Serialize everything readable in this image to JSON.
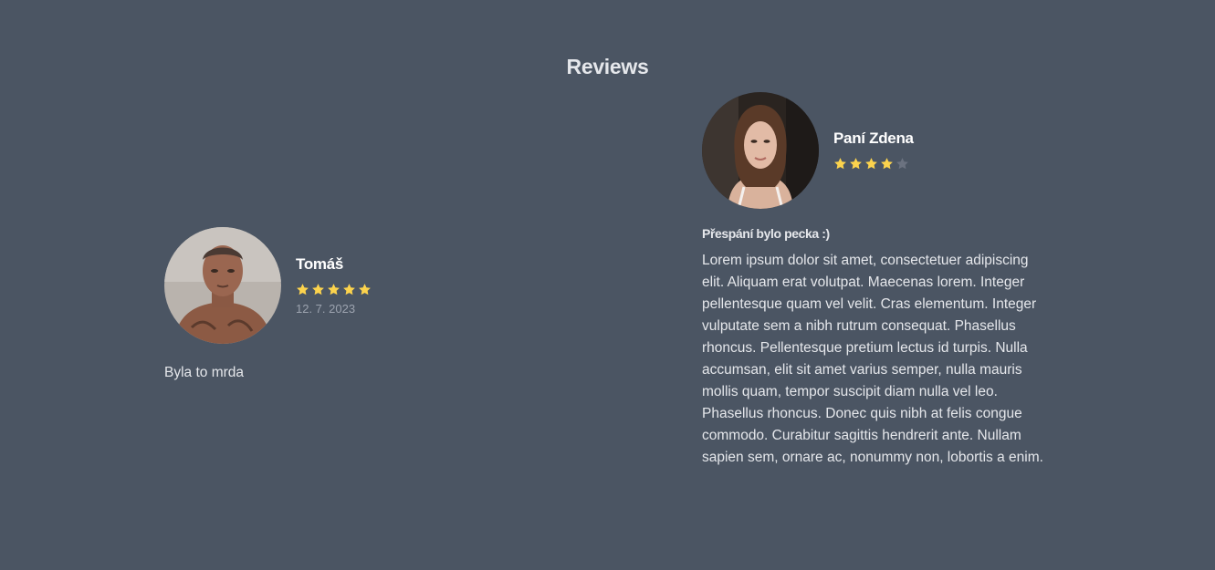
{
  "section": {
    "title": "Reviews"
  },
  "colors": {
    "background": "#4b5563",
    "star_filled": "#fcd34d",
    "star_empty": "#6b7280"
  },
  "reviews": [
    {
      "name": "Tomáš",
      "rating": 5,
      "max_rating": 5,
      "date": "12. 7. 2023",
      "heading": "",
      "text": "Byla to mrda",
      "avatar": "avatar-photo-man"
    },
    {
      "name": "Paní Zdena",
      "rating": 4,
      "max_rating": 5,
      "date": "",
      "heading": "Přespání bylo pecka :)",
      "text": "Lorem ipsum dolor sit amet, consectetuer adipiscing elit. Aliquam erat volutpat. Maecenas lorem. Integer pellentesque quam vel velit. Cras elementum. Integer vulputate sem a nibh rutrum consequat. Phasellus rhoncus. Pellentesque pretium lectus id turpis. Nulla accumsan, elit sit amet varius semper, nulla mauris mollis quam, tempor suscipit diam nulla vel leo. Phasellus rhoncus. Donec quis nibh at felis congue commodo. Curabitur sagittis hendrerit ante. Nullam sapien sem, ornare ac, nonummy non, lobortis a enim.",
      "avatar": "avatar-photo-woman"
    }
  ]
}
